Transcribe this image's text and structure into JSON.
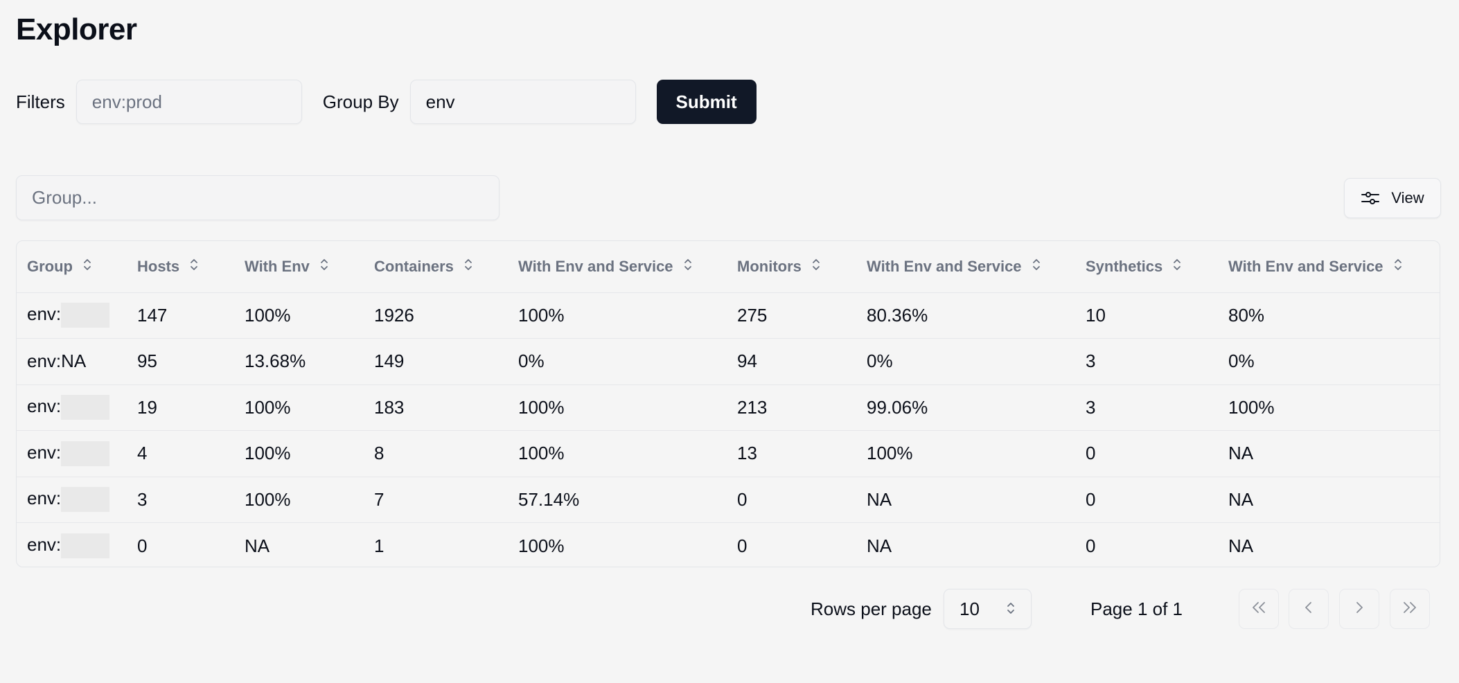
{
  "header": {
    "title": "Explorer"
  },
  "filters": {
    "filters_label": "Filters",
    "filters_placeholder": "env:prod",
    "filters_value": "",
    "groupby_label": "Group By",
    "groupby_value": "env",
    "submit_label": "Submit"
  },
  "toolbar": {
    "group_search_placeholder": "Group...",
    "view_label": "View"
  },
  "table": {
    "columns": [
      "Group",
      "Hosts",
      "With Env",
      "Containers",
      "With Env and Service",
      "Monitors",
      "With Env and Service",
      "Synthetics",
      "With Env and Service"
    ],
    "rows": [
      {
        "group": "env:",
        "redacted": true,
        "cells": [
          "147",
          "100%",
          "1926",
          "100%",
          "275",
          "80.36%",
          "10",
          "80%"
        ]
      },
      {
        "group": "env:NA",
        "redacted": false,
        "cells": [
          "95",
          "13.68%",
          "149",
          "0%",
          "94",
          "0%",
          "3",
          "0%"
        ]
      },
      {
        "group": "env:",
        "redacted": true,
        "cells": [
          "19",
          "100%",
          "183",
          "100%",
          "213",
          "99.06%",
          "3",
          "100%"
        ]
      },
      {
        "group": "env:",
        "redacted": true,
        "cells": [
          "4",
          "100%",
          "8",
          "100%",
          "13",
          "100%",
          "0",
          "NA"
        ]
      },
      {
        "group": "env:",
        "redacted": true,
        "cells": [
          "3",
          "100%",
          "7",
          "57.14%",
          "0",
          "NA",
          "0",
          "NA"
        ]
      },
      {
        "group": "env:",
        "redacted": true,
        "cells": [
          "0",
          "NA",
          "1",
          "100%",
          "0",
          "NA",
          "0",
          "NA"
        ]
      }
    ]
  },
  "pagination": {
    "rows_per_page_label": "Rows per page",
    "rows_per_page_value": "10",
    "page_info": "Page 1 of 1"
  },
  "colors": {
    "background": "#f5f5f5",
    "primary_button": "#111827",
    "header_text": "#6b7280",
    "border": "#e3e5e9"
  },
  "icons": {
    "sort": "chevrons-up-down-icon",
    "view": "sliders-horizontal-icon",
    "first": "chevrons-left-icon",
    "prev": "chevron-left-icon",
    "next": "chevron-right-icon",
    "last": "chevrons-right-icon"
  }
}
